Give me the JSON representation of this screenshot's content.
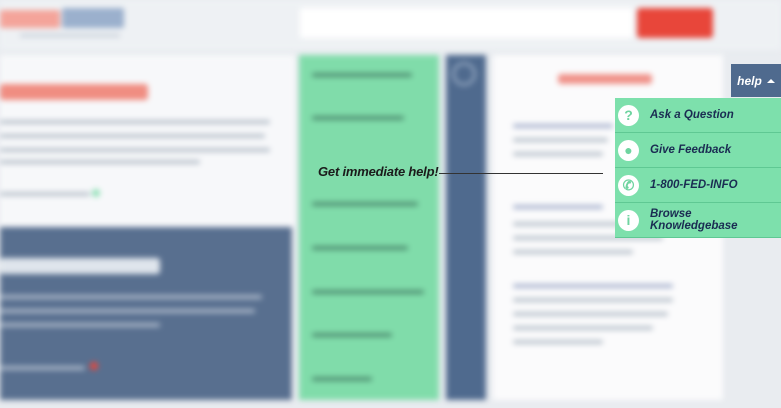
{
  "callout": {
    "text": "Get immediate help!"
  },
  "help_widget": {
    "tab_label": "help",
    "items": [
      {
        "icon": "question-icon",
        "glyph": "?",
        "label": "Ask a Question"
      },
      {
        "icon": "lightbulb-icon",
        "glyph": "●",
        "label": "Give Feedback"
      },
      {
        "icon": "phone-icon",
        "glyph": "✆",
        "label": "1-800-FED-INFO"
      },
      {
        "icon": "info-icon",
        "glyph": "i",
        "label": "Browse Knowledgebase"
      }
    ]
  },
  "colors": {
    "accent_green": "#7de0ac",
    "navy": "#4f6a8e",
    "brand_red": "#e8463a",
    "text_navy": "#1a2c52"
  }
}
